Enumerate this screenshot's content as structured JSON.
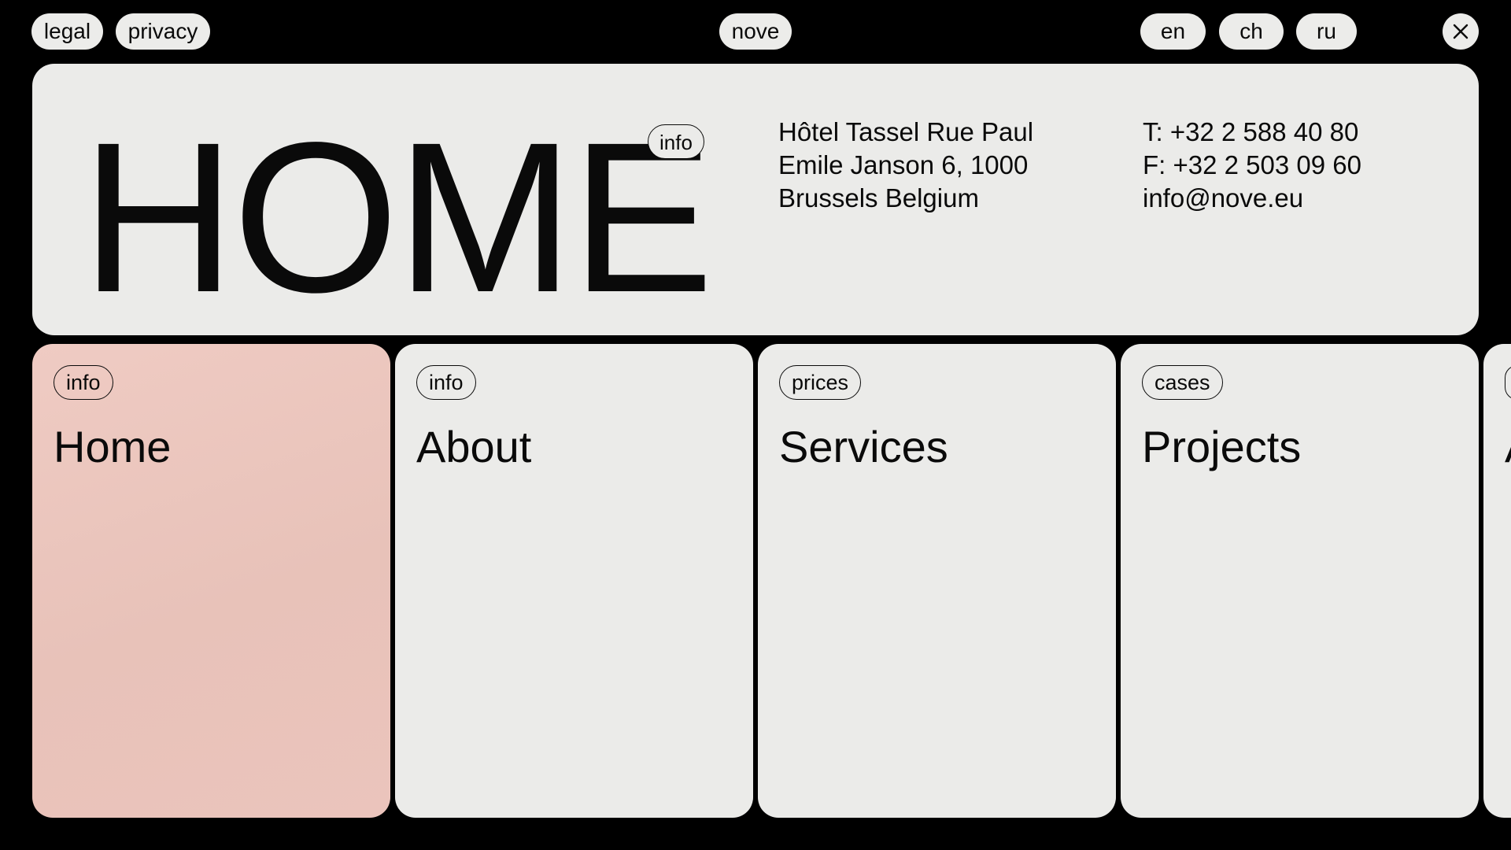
{
  "topbar": {
    "links": [
      {
        "label": "legal"
      },
      {
        "label": "privacy"
      }
    ],
    "brand": "nove",
    "languages": [
      {
        "label": "en"
      },
      {
        "label": "ch"
      },
      {
        "label": "ru"
      }
    ],
    "close_icon": "close-icon"
  },
  "hero": {
    "title": "HOME",
    "badge": "info",
    "address": [
      "Hôtel Tassel Rue Paul",
      "Emile Janson 6, 1000",
      "Brussels Belgium"
    ],
    "contact": [
      "T: +32 2 588 40 80",
      "F: +32 2 503 09 60",
      "info@nove.eu"
    ]
  },
  "cards": [
    {
      "tag": "info",
      "title": "Home",
      "active": true
    },
    {
      "tag": "info",
      "title": "About",
      "active": false
    },
    {
      "tag": "prices",
      "title": "Services",
      "active": false
    },
    {
      "tag": "cases",
      "title": "Projects",
      "active": false
    },
    {
      "tag": "",
      "title": "A",
      "active": false
    }
  ],
  "colors": {
    "background": "#000000",
    "panel": "#ebebe9",
    "active_card": "#e9c4bb",
    "text": "#0a0a0a"
  }
}
